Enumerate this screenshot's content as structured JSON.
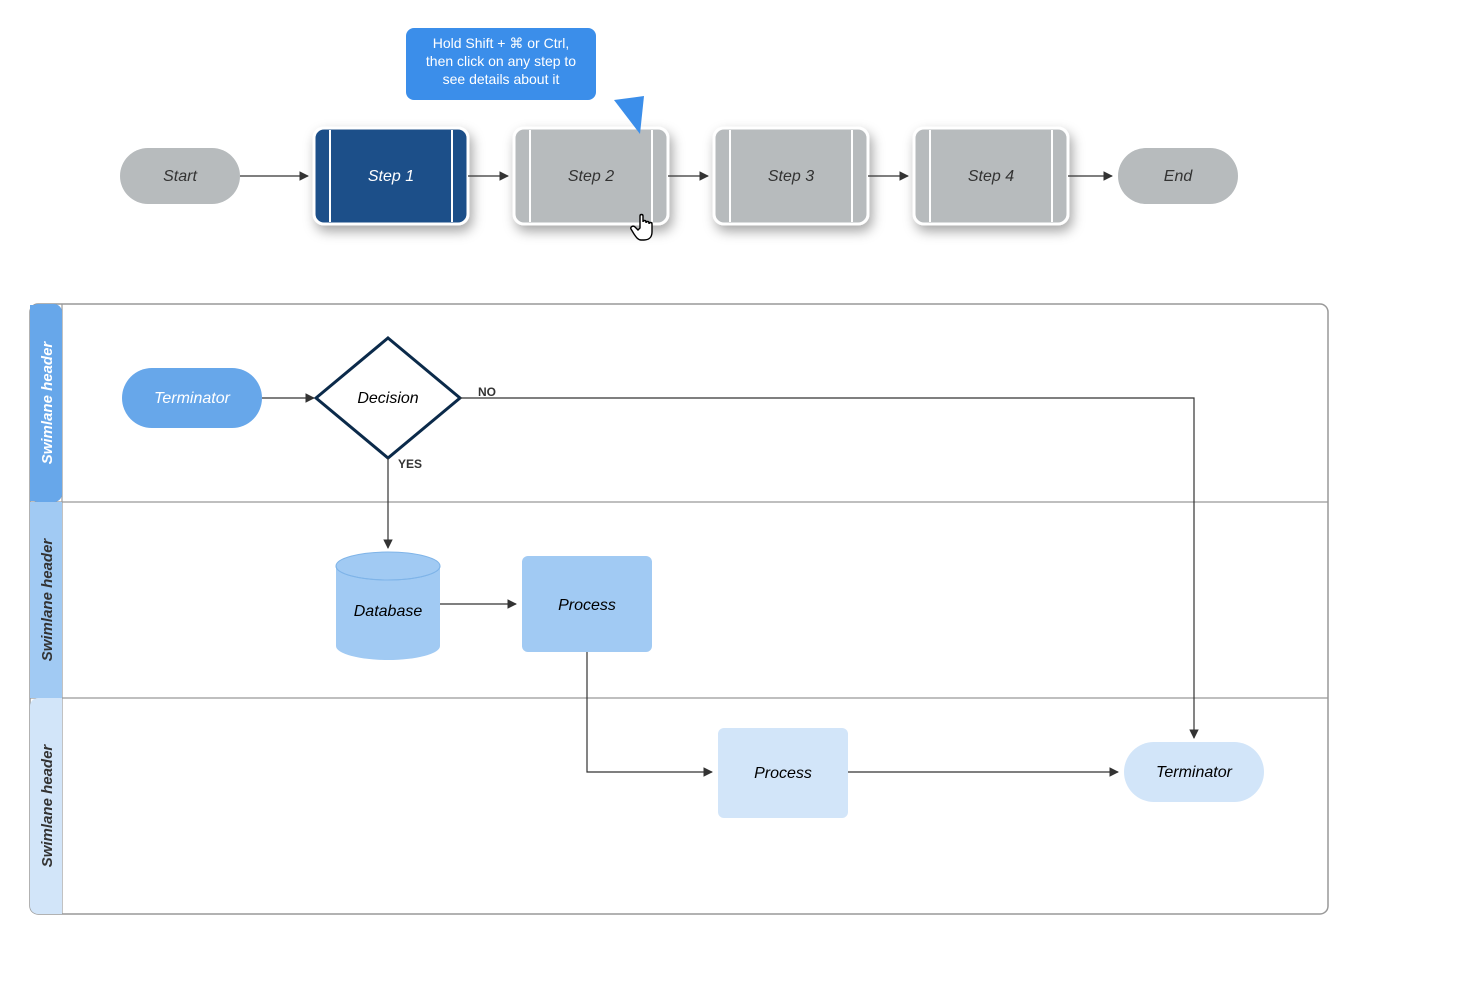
{
  "tooltip": {
    "line1": "Hold Shift + ⌘ or Ctrl,",
    "line2": "then click on any step to",
    "line3": "see details about it"
  },
  "flow": {
    "start": "Start",
    "steps": [
      "Step 1",
      "Step 2",
      "Step 3",
      "Step 4"
    ],
    "end": "End"
  },
  "swimlane": {
    "headers": [
      "Swimlane header",
      "Swimlane header",
      "Swimlane header"
    ],
    "terminator_start": "Terminator",
    "decision": "Decision",
    "decision_no": "NO",
    "decision_yes": "YES",
    "database": "Database",
    "process1": "Process",
    "process2": "Process",
    "terminator_end": "Terminator"
  },
  "colors": {
    "grey": "#b7bbbd",
    "blue_dark": "#1d4f89",
    "blue_mid": "#67a7ea",
    "blue_light": "#a1caf3",
    "blue_pale": "#d2e5f9",
    "navy": "#0b2a4a"
  }
}
